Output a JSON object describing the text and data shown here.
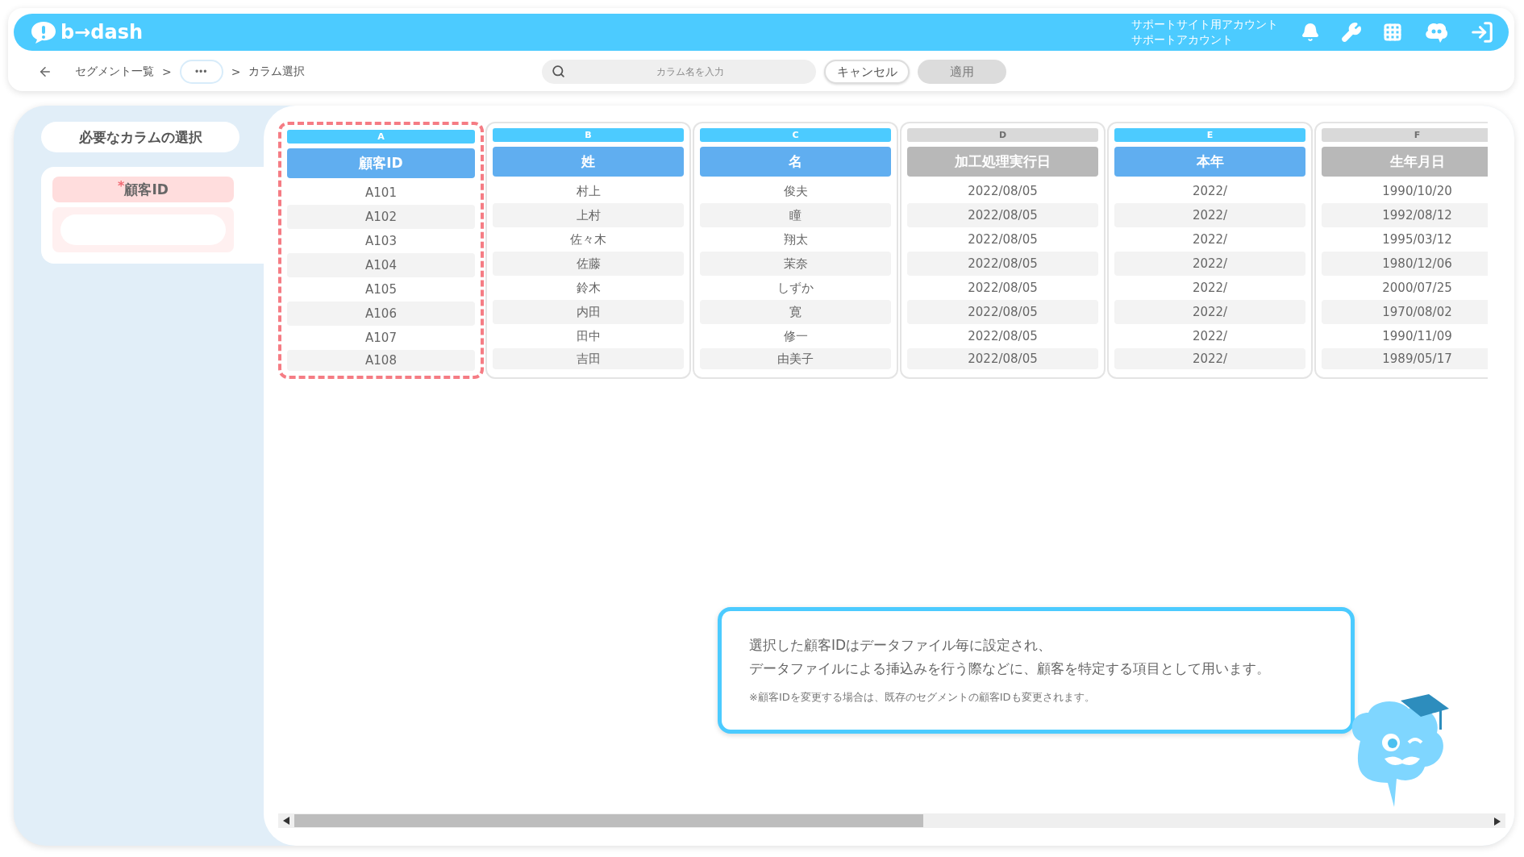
{
  "header": {
    "logo": "b→dash",
    "account": [
      "サポートサイト用アカウント",
      "サポートアカウント"
    ]
  },
  "breadcrumb": [
    {
      "kind": "link",
      "label": "セグメント一覧"
    },
    {
      "kind": "separator",
      "label": ">"
    },
    {
      "kind": "more",
      "label": "•••"
    },
    {
      "kind": "separator",
      "label": ">"
    },
    {
      "kind": "current",
      "label": "カラム選択"
    }
  ],
  "search": {
    "placeholder": "カラム名を入力"
  },
  "buttons": [
    {
      "label": "キャンセル",
      "disabled": false
    },
    {
      "label": "適用",
      "disabled": true
    }
  ],
  "sidebar": {
    "title": "必要なカラムの選択",
    "required_field": {
      "marker": "*",
      "label": "顧客ID"
    }
  },
  "columns": [
    {
      "letter": "A",
      "name": "顧客ID",
      "selected": true,
      "highlighted": true,
      "cells": [
        "A101",
        "A102",
        "A103",
        "A104",
        "A105",
        "A106",
        "A107",
        "A108"
      ]
    },
    {
      "letter": "B",
      "name": "姓",
      "selected": true,
      "highlighted": false,
      "cells": [
        "村上",
        "上村",
        "佐々木",
        "佐藤",
        "鈴木",
        "内田",
        "田中",
        "吉田"
      ]
    },
    {
      "letter": "C",
      "name": "名",
      "selected": true,
      "highlighted": false,
      "cells": [
        "俊夫",
        "瞳",
        "翔太",
        "茉奈",
        "しずか",
        "寛",
        "修一",
        "由美子"
      ]
    },
    {
      "letter": "D",
      "name": "加工処理実行日",
      "selected": false,
      "highlighted": false,
      "cells": [
        "2022/08/05",
        "2022/08/05",
        "2022/08/05",
        "2022/08/05",
        "2022/08/05",
        "2022/08/05",
        "2022/08/05",
        "2022/08/05"
      ]
    },
    {
      "letter": "E",
      "name": "本年",
      "selected": true,
      "highlighted": false,
      "cells": [
        "2022/",
        "2022/",
        "2022/",
        "2022/",
        "2022/",
        "2022/",
        "2022/",
        "2022/"
      ]
    },
    {
      "letter": "F",
      "name": "生年月日",
      "selected": false,
      "highlighted": false,
      "cells": [
        "1990/10/20",
        "1992/08/12",
        "1995/03/12",
        "1980/12/06",
        "2000/07/25",
        "1970/08/02",
        "1990/11/09",
        "1989/05/17"
      ]
    }
  ],
  "callout": {
    "lines": [
      "選択した顧客IDはデータファイル毎に設定され、",
      "データファイルによる挿込みを行う際などに、顧客を特定する項目として用います。"
    ],
    "note": "※顧客IDを変更する場合は、既存のセグメントの顧客IDも変更されます。"
  }
}
